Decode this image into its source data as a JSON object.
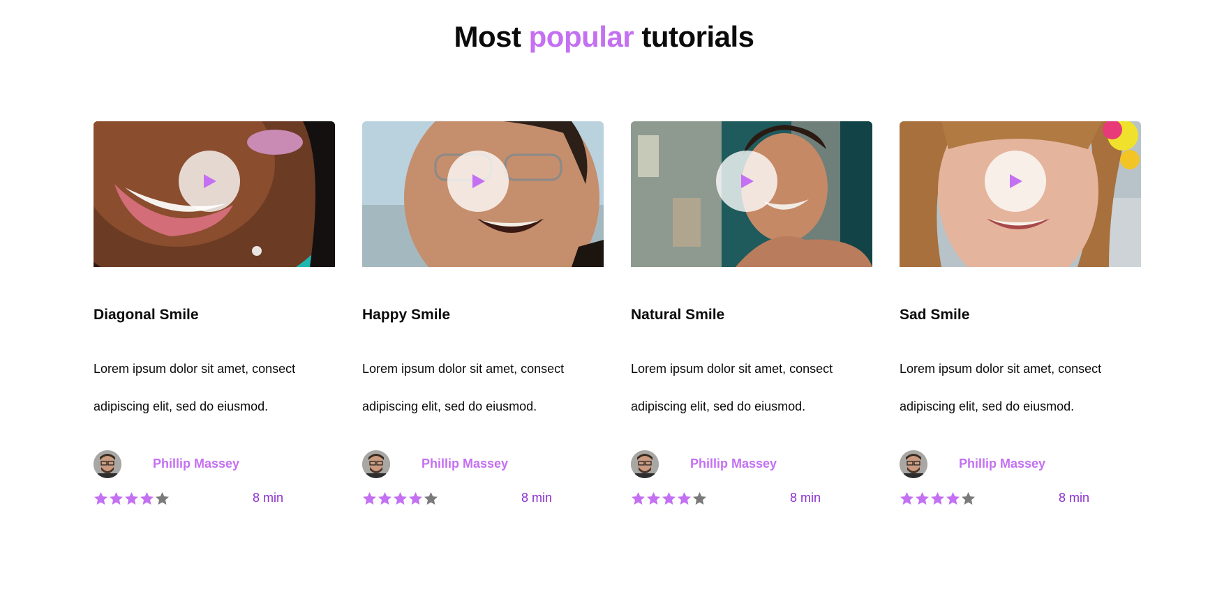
{
  "heading": {
    "before": "Most",
    "accent": "popular",
    "after": "tutorials"
  },
  "colors": {
    "accent": "#c470f2",
    "duration": "#8a2fcf",
    "star_off": "#7a7a7a"
  },
  "icons": {
    "play": "play-icon",
    "star": "star-icon"
  },
  "tutorials": [
    {
      "title": "Diagonal Smile",
      "description_line1": "Lorem ipsum dolor sit amet, consect",
      "description_line2": "adipiscing elit, sed do eiusmod.",
      "author": "Phillip Massey",
      "rating": 4,
      "rating_max": 5,
      "duration": "8 min"
    },
    {
      "title": "Happy Smile",
      "description_line1": "Lorem ipsum dolor sit amet, consect",
      "description_line2": "adipiscing elit, sed do eiusmod.",
      "author": "Phillip Massey",
      "rating": 4,
      "rating_max": 5,
      "duration": "8 min"
    },
    {
      "title": "Natural Smile",
      "description_line1": "Lorem ipsum dolor sit amet, consect",
      "description_line2": "adipiscing elit, sed do eiusmod.",
      "author": "Phillip Massey",
      "rating": 4,
      "rating_max": 5,
      "duration": "8 min"
    },
    {
      "title": "Sad Smile",
      "description_line1": "Lorem ipsum dolor sit amet, consect",
      "description_line2": "adipiscing elit, sed do eiusmod.",
      "author": "Phillip Massey",
      "rating": 4,
      "rating_max": 5,
      "duration": "8 min"
    }
  ]
}
